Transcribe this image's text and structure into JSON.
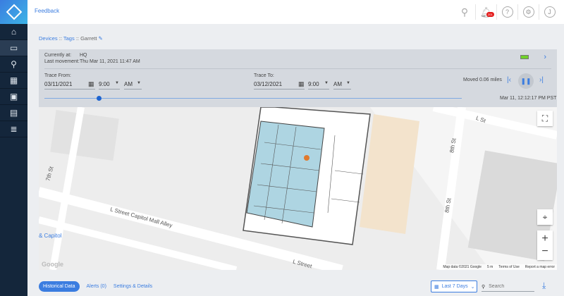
{
  "header": {
    "feedback": "Feedback",
    "notification_count": "201",
    "user_initial": "J"
  },
  "breadcrumb": {
    "devices": "Devices",
    "sep": " :: ",
    "tags": "Tags",
    "name": "Garrett"
  },
  "status": {
    "currently_at_label": "Currently at:",
    "currently_at": "HQ",
    "last_movement_label": "Last movement:",
    "last_movement": "Thu Mar 11, 2021 11:47 AM"
  },
  "trace": {
    "from_label": "Trace From:",
    "from_date": "03/11/2021",
    "from_time": "9:00",
    "from_ampm": "AM",
    "to_label": "Trace To:",
    "to_date": "03/12/2021",
    "to_time": "9:00",
    "to_ampm": "AM",
    "moved": "Moved 0.06 miles",
    "timestamp": "Mar 11, 12:12:17 PM PST",
    "progress_percent": 13
  },
  "map": {
    "streets": [
      "L St",
      "8th St",
      "7th St",
      "L Street Capitol Mall Alley",
      "8th St",
      "L Street"
    ],
    "poi": "& Capitol",
    "google": "Google",
    "attribution": [
      "Map data ©2021 Google",
      "5 m",
      "Terms of Use",
      "Report a map error"
    ]
  },
  "bottom": {
    "tabs": [
      "Historical Data",
      "Alerts (0)",
      "Settings & Details"
    ],
    "range": "Last 7 Days",
    "search_placeholder": "Search"
  }
}
